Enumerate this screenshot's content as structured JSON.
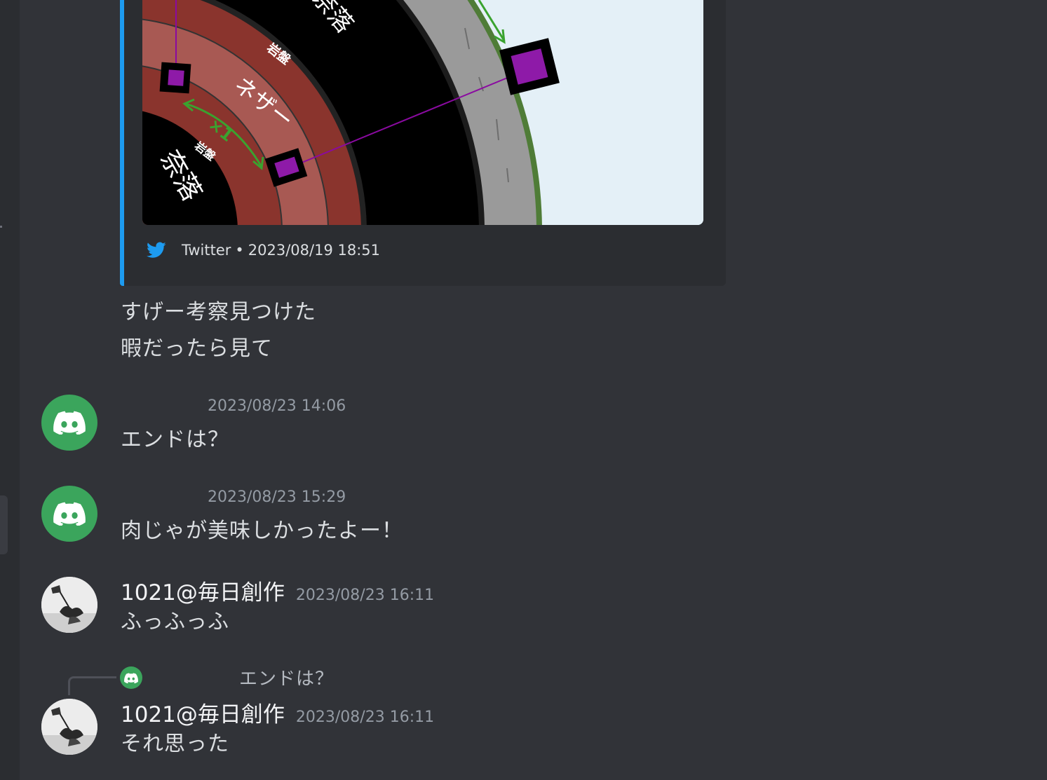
{
  "embed": {
    "source": "Twitter",
    "separator": "•",
    "timestamp": "2023/08/19 18:51",
    "accent_color": "#1d9bf0",
    "icon": "twitter-bird-icon",
    "image_labels": {
      "bedrock_outer": "岩盤",
      "bedrock_inner": "岩盤",
      "nether": "ネザー",
      "scale": "×1",
      "void_top": "奈落",
      "void_bottom": "奈落"
    }
  },
  "first_message": {
    "lines": [
      "すげー考察見つけた",
      "暇だったら見て"
    ]
  },
  "messages": [
    {
      "avatar": "discord-default-avatar-icon",
      "username": "",
      "timestamp": "2023/08/23 14:06",
      "content": "エンドは？"
    },
    {
      "avatar": "discord-default-avatar-icon",
      "username": "",
      "timestamp": "2023/08/23 15:29",
      "content": "肉じゃが美味しかったよー！"
    },
    {
      "avatar": "user-photo-avatar",
      "username": "1021@毎日創作",
      "timestamp": "2023/08/23 16:11",
      "content": "ふっふっふ"
    },
    {
      "avatar": "user-photo-avatar",
      "username": "1021@毎日創作",
      "timestamp": "2023/08/23 16:11",
      "content": "それ思った",
      "reply": {
        "avatar": "discord-default-avatar-icon",
        "username": "",
        "content": "エンドは？"
      }
    }
  ],
  "colors": {
    "background": "#313338",
    "discord_green": "#3ba55c",
    "timestamp": "#949ba4"
  }
}
